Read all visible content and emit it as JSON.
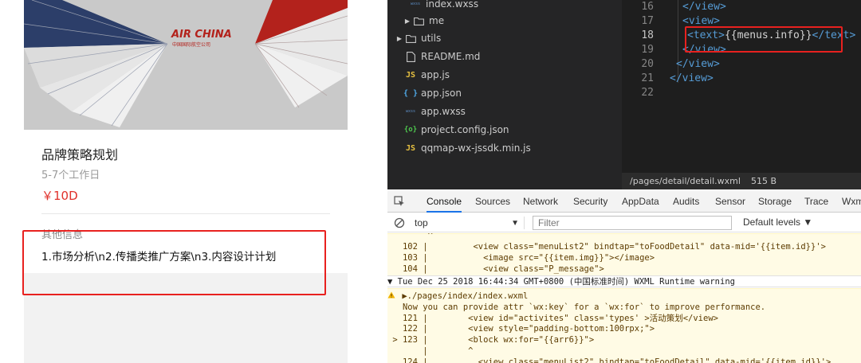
{
  "simulator": {
    "hero_brand": "AIR CHINA",
    "hero_brand_sub": "中国国际航空公司",
    "card": {
      "title": "品牌策略规划",
      "subtitle": "5-7个工作日",
      "price": "￥10D",
      "section_label": "其他信息",
      "info_text": "1.市场分析\\n2.传播类推广方案\\n3.内容设计计划"
    },
    "highlight_color": "#e8211f"
  },
  "file_tree": {
    "items": [
      {
        "label": "index.wxss",
        "icon": "wxss-file-icon",
        "kind": "wxss"
      },
      {
        "label": "me",
        "icon": "folder-icon",
        "kind": "folder"
      },
      {
        "label": "utils",
        "icon": "folder-icon",
        "kind": "folder"
      },
      {
        "label": "README.md",
        "icon": "file-icon",
        "kind": "file"
      },
      {
        "label": "app.js",
        "icon": "js-file-icon",
        "kind": "js"
      },
      {
        "label": "app.json",
        "icon": "json-file-icon",
        "kind": "json"
      },
      {
        "label": "app.wxss",
        "icon": "wxss-file-icon",
        "kind": "wxss"
      },
      {
        "label": "project.config.json",
        "icon": "config-file-icon",
        "kind": "cfg"
      },
      {
        "label": "qqmap-wx-jssdk.min.js",
        "icon": "js-file-icon",
        "kind": "js"
      }
    ],
    "icon_glyphs": {
      "js": "JS",
      "json": "{ }",
      "wxss": "wxss",
      "cfg": "{o}"
    }
  },
  "editor": {
    "lines": [
      {
        "num": "16",
        "open": "</",
        "tag": "view",
        "close": ">",
        "text": ""
      },
      {
        "num": "17",
        "open": "<",
        "tag": "view",
        "close": ">",
        "text": ""
      },
      {
        "num": "18",
        "open": "<",
        "tag": "text",
        "close": ">",
        "text": "{{menus.info}}",
        "end": "</text>"
      },
      {
        "num": "19",
        "open": "</",
        "tag": "view",
        "close": ">",
        "text": ""
      },
      {
        "num": "20",
        "open": "</",
        "tag": "view",
        "close": ">",
        "text": ""
      },
      {
        "num": "21",
        "open": "</",
        "tag": "view",
        "close": ">",
        "text": ""
      },
      {
        "num": "22",
        "open": "",
        "tag": "",
        "close": "",
        "text": ""
      }
    ],
    "status_path": "/pages/detail/detail.wxml",
    "status_size": "515 B"
  },
  "devtools": {
    "tabs": [
      "Console",
      "Sources",
      "Network",
      "Security",
      "AppData",
      "Audits",
      "Sensor",
      "Storage",
      "Trace",
      "Wxml"
    ],
    "active_tab": "Console",
    "context": "top",
    "filter_placeholder": "Filter",
    "levels": "Default levels ▼",
    "console_lines": [
      "        ^",
      "   102 |         <view class=\"menuList2\" bindtap=\"toFoodDetail\" data-mid='{{item.id}}'>",
      "   103 |           <image src=\"{{item.img}}\"></image>",
      "   104 |           <view class=\"P_message\">"
    ],
    "group_header": "▼ Tue Dec 25 2018 16:44:34 GMT+0800 (中国标准时间) WXML Runtime warning",
    "warning_lines": [
      " ▶./pages/index/index.wxml",
      "   Now you can provide attr `wx:key` for a `wx:for` to improve performance.",
      "   121 |        <view id=\"activites\" class='types' >活动策划</view>",
      "   122 |        <view style=\"padding-bottom:100rpx;\">",
      " > 123 |        <block wx:for=\"{{arr6}}\">",
      "       |        ^",
      "   124 |          <view class=\"menuList2\" bindtap=\"toFoodDetail\" data-mid='{{item.id}}'>"
    ]
  }
}
